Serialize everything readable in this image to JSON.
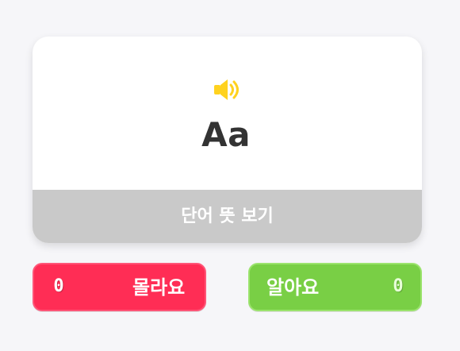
{
  "card": {
    "word": "Aa",
    "speaker_icon": "speaker-icon",
    "reveal_label": "단어 뜻 보기"
  },
  "buttons": {
    "dont_know": {
      "label": "몰라요",
      "count": "0"
    },
    "know": {
      "label": "알아요",
      "count": "0"
    }
  },
  "colors": {
    "background": "#f6f6f9",
    "card": "#ffffff",
    "reveal": "#c9c9c9",
    "dont_know": "#ff2d55",
    "know": "#79cf45",
    "speaker": "#ffd21f",
    "word": "#333333"
  }
}
